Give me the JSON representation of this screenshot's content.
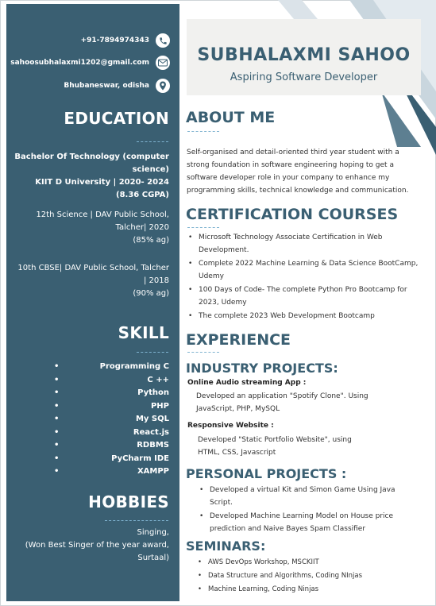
{
  "contact": {
    "phone": "+91-7894974343",
    "email": "sahoosubhalaxmi1202@gmail.com",
    "location": "Bhubaneswar, odisha"
  },
  "header": {
    "name": "SUBHALAXMI SAHOO",
    "role": "Aspiring Software Developer"
  },
  "education": {
    "title": "EDUCATION",
    "degree_line1": "Bachelor Of Technology (computer",
    "degree_line2": "science)",
    "degree_line3": "KIIT D University | 2020- 2024",
    "degree_line4": "(8.36 CGPA)",
    "twelfth_line1": "12th Science | DAV Public School,",
    "twelfth_line2": "Talcher| 2020",
    "twelfth_line3": "(85% ag)",
    "tenth_line1": "10th CBSE| DAV Public School, Talcher",
    "tenth_line2": "| 2018",
    "tenth_line3": "(90% ag)"
  },
  "skill": {
    "title": "SKILL",
    "items": [
      "Programming C",
      "C ++",
      "Python",
      "PHP",
      "My SQL",
      "React.js",
      "RDBMS",
      "PyCharm IDE",
      "XAMPP"
    ]
  },
  "hobbies": {
    "title": "HOBBIES",
    "line1": "Singing,",
    "line2": "(Won Best Singer of the year award,",
    "line3": "Surtaal)"
  },
  "about": {
    "title": "ABOUT ME",
    "line1": "Self-organised and detail-oriented third year student with a",
    "line2": "strong foundation in software engineering hoping to get a",
    "line3": "software developer role in your company to enhance my",
    "line4": "programming skills, technical knowledge and communication."
  },
  "certification": {
    "title": "CERTIFICATION COURSES",
    "items": [
      {
        "l1": "Microsoft Technology Associate Certification in Web",
        "l2": "Development."
      },
      {
        "l1": "Complete 2022 Machine Learning & Data Science BootCamp,",
        "l2": "Udemy"
      },
      {
        "l1": "100 Days of Code- The complete Python Pro Bootcamp for",
        "l2": "2023, Udemy"
      },
      {
        "l1": "The complete  2023 Web Development Bootcamp",
        "l2": ""
      }
    ]
  },
  "experience": {
    "title": "EXPERIENCE",
    "industry_title": "INDUSTRY PROJECTS:",
    "p1_head": "Online Audio streaming App :",
    "p1_line1": "Developed an application  \"Spotify Clone\". Using",
    "p1_line2": "JavaScript, PHP, MySQL",
    "p2_head": "Responsive Website :",
    "p2_line1": "Developed \"Static Portfolio Website\", using",
    "p2_line2": "HTML, CSS, Javascript",
    "personal_title": "PERSONAL PROJECTS :",
    "personal_items": [
      {
        "l1": "Developed a  virtual Kit and Simon Game Using Java",
        "l2": "Script."
      },
      {
        "l1": "Developed Machine Learning Model  on House price",
        "l2": "prediction and Naive Bayes Spam Classifier"
      }
    ],
    "seminars_title": "SEMINARS:",
    "seminar_items": [
      "AWS DevOps Workshop, MSCKIIT",
      "Data Structure and Algorithms, Coding NInjas",
      "Machine Learning, Coding Ninjas"
    ]
  },
  "colors": {
    "sidebar": "#3a5f72",
    "accent": "#3a5f72",
    "dash": "#7fb3d0"
  }
}
